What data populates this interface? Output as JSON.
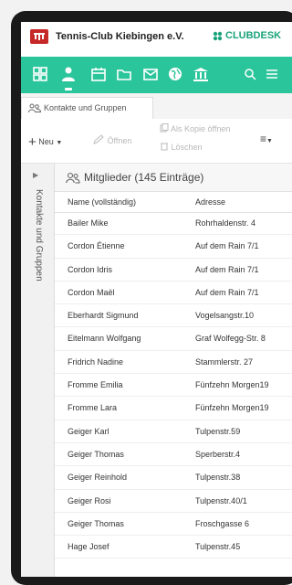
{
  "header": {
    "club_name": "Tennis-Club Kiebingen e.V.",
    "brand": "CLUBDESK",
    "accent_color": "#2bc59b",
    "logo_color": "#c62828"
  },
  "nav": {
    "icons": [
      "dashboard-icon",
      "person-icon",
      "calendar-icon",
      "folder-icon",
      "mail-icon",
      "globe-icon",
      "bank-icon",
      "search-icon",
      "menu-icon"
    ]
  },
  "tab": {
    "label": "Kontakte und Gruppen"
  },
  "actions": {
    "new_label": "Neu",
    "open_label": "Öffnen",
    "open_copy_label": "Als Kopie öffnen",
    "delete_label": "Löschen"
  },
  "side": {
    "label": "Kontakte und Gruppen"
  },
  "list": {
    "title": "Mitglieder (145 Einträge)",
    "columns": [
      "Name (vollständig)",
      "Adresse"
    ],
    "rows": [
      [
        "Bailer Mike",
        "Rohrhaldenstr. 4"
      ],
      [
        "Cordon Étienne",
        "Auf dem Rain 7/1"
      ],
      [
        "Cordon Idris",
        "Auf dem Rain 7/1"
      ],
      [
        "Cordon Maël",
        "Auf dem Rain 7/1"
      ],
      [
        "Eberhardt Sigmund",
        "Vogelsangstr.10"
      ],
      [
        "Eitelmann Wolfgang",
        "Graf Wolfegg-Str. 8"
      ],
      [
        "Fridrich Nadine",
        "Stammlerstr. 27"
      ],
      [
        "Fromme Emilia",
        "Fünfzehn Morgen19"
      ],
      [
        "Fromme Lara",
        "Fünfzehn Morgen19"
      ],
      [
        "Geiger Karl",
        "Tulpenstr.59"
      ],
      [
        "Geiger Thomas",
        "Sperberstr.4"
      ],
      [
        "Geiger Reinhold",
        "Tulpenstr.38"
      ],
      [
        "Geiger Rosi",
        "Tulpenstr.40/1"
      ],
      [
        "Geiger Thomas",
        "Froschgasse 6"
      ],
      [
        "Hage Josef",
        "Tulpenstr.45"
      ]
    ]
  }
}
